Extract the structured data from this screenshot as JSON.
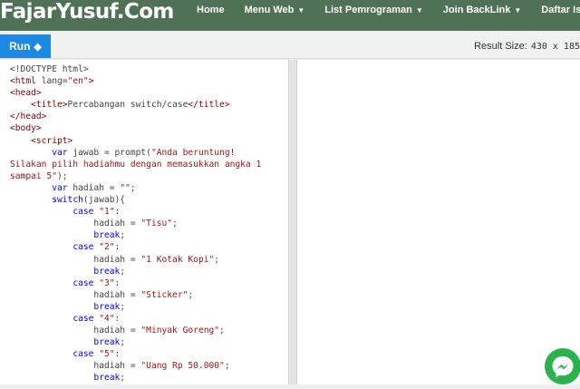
{
  "site": {
    "logo": "FajarYusuf.Com"
  },
  "nav": {
    "items": [
      {
        "label": "Home",
        "has_dropdown": false
      },
      {
        "label": "Menu Web",
        "has_dropdown": true
      },
      {
        "label": "List Pemrograman",
        "has_dropdown": true
      },
      {
        "label": "Join BackLink",
        "has_dropdown": true
      },
      {
        "label": "Daftar Isi",
        "has_dropdown": false
      }
    ]
  },
  "toolbar": {
    "run_label": "Run",
    "result_size_label": "Result Size:",
    "result_size_value": "430 x 185"
  },
  "colors": {
    "nav_bg": "#4f7257",
    "run_button": "#1e88e5",
    "tag": "#800000",
    "keyword": "#0000ff",
    "string": "#a31515",
    "messenger": "#2bb24c"
  },
  "icons": {
    "run": "diamond-icon",
    "dropdown": "caret-down-icon",
    "chat": "messenger-icon"
  },
  "code": {
    "lines": [
      [
        [
          "d",
          "<!DOCTYPE html>"
        ]
      ],
      [
        [
          "t",
          "<html"
        ],
        [
          "d",
          " lang="
        ],
        [
          "s",
          "\"en\""
        ],
        [
          "t",
          ">"
        ]
      ],
      [
        [
          "t",
          "<head>"
        ]
      ],
      [
        [
          "d",
          "    "
        ],
        [
          "t",
          "<title>"
        ],
        [
          "d",
          "Percabangan switch/case"
        ],
        [
          "t",
          "</title>"
        ]
      ],
      [
        [
          "t",
          "</head>"
        ]
      ],
      [
        [
          "t",
          "<body>"
        ]
      ],
      [
        [
          "d",
          "    "
        ],
        [
          "t",
          "<script>"
        ]
      ],
      [
        [
          "d",
          "        "
        ],
        [
          "k",
          "var"
        ],
        [
          "d",
          " jawab = prompt("
        ],
        [
          "s",
          "\"Anda beruntung!"
        ]
      ],
      [
        [
          "s",
          "Silakan pilih hadiahmu dengan memasukkan angka 1"
        ]
      ],
      [
        [
          "s",
          "sampai 5\""
        ],
        [
          "d",
          ");"
        ]
      ],
      [
        [
          "d",
          "        "
        ],
        [
          "k",
          "var"
        ],
        [
          "d",
          " hadiah = "
        ],
        [
          "s",
          "\"\""
        ],
        [
          "d",
          ";"
        ]
      ],
      [
        [
          "d",
          "        "
        ],
        [
          "k",
          "switch"
        ],
        [
          "d",
          "(jawab){"
        ]
      ],
      [
        [
          "d",
          "            "
        ],
        [
          "k",
          "case"
        ],
        [
          "d",
          " "
        ],
        [
          "s",
          "\"1\""
        ],
        [
          "d",
          ":"
        ]
      ],
      [
        [
          "d",
          "                hadiah = "
        ],
        [
          "s",
          "\"Tisu\""
        ],
        [
          "d",
          ";"
        ]
      ],
      [
        [
          "d",
          "                "
        ],
        [
          "k",
          "break"
        ],
        [
          "d",
          ";"
        ]
      ],
      [
        [
          "d",
          "            "
        ],
        [
          "k",
          "case"
        ],
        [
          "d",
          " "
        ],
        [
          "s",
          "\"2\""
        ],
        [
          "d",
          ":"
        ]
      ],
      [
        [
          "d",
          "                hadiah = "
        ],
        [
          "s",
          "\"1 Kotak Kopi\""
        ],
        [
          "d",
          ";"
        ]
      ],
      [
        [
          "d",
          "                "
        ],
        [
          "k",
          "break"
        ],
        [
          "d",
          ";"
        ]
      ],
      [
        [
          "d",
          "            "
        ],
        [
          "k",
          "case"
        ],
        [
          "d",
          " "
        ],
        [
          "s",
          "\"3\""
        ],
        [
          "d",
          ":"
        ]
      ],
      [
        [
          "d",
          "                hadiah = "
        ],
        [
          "s",
          "\"Sticker\""
        ],
        [
          "d",
          ";"
        ]
      ],
      [
        [
          "d",
          "                "
        ],
        [
          "k",
          "break"
        ],
        [
          "d",
          ";"
        ]
      ],
      [
        [
          "d",
          "            "
        ],
        [
          "k",
          "case"
        ],
        [
          "d",
          " "
        ],
        [
          "s",
          "\"4\""
        ],
        [
          "d",
          ":"
        ]
      ],
      [
        [
          "d",
          "                hadiah = "
        ],
        [
          "s",
          "\"Minyak Goreng\""
        ],
        [
          "d",
          ";"
        ]
      ],
      [
        [
          "d",
          "                "
        ],
        [
          "k",
          "break"
        ],
        [
          "d",
          ";"
        ]
      ],
      [
        [
          "d",
          "            "
        ],
        [
          "k",
          "case"
        ],
        [
          "d",
          " "
        ],
        [
          "s",
          "\"5\""
        ],
        [
          "d",
          ":"
        ]
      ],
      [
        [
          "d",
          "                hadiah = "
        ],
        [
          "s",
          "\"Uang Rp 50.000\""
        ],
        [
          "d",
          ";"
        ]
      ],
      [
        [
          "d",
          "                "
        ],
        [
          "k",
          "break"
        ],
        [
          "d",
          ";"
        ]
      ]
    ]
  }
}
